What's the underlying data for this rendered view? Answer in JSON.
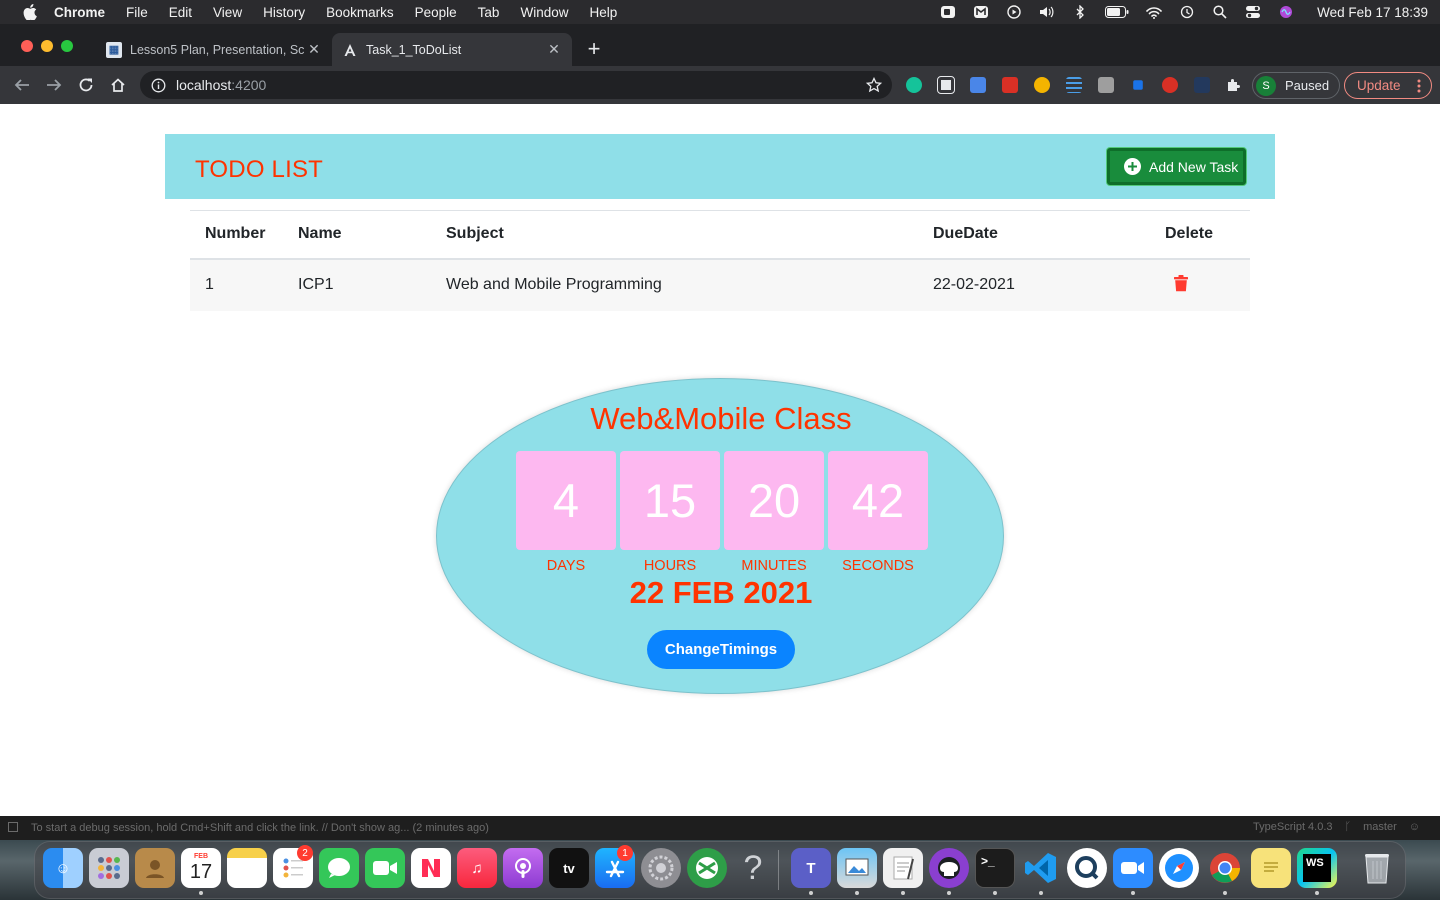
{
  "menubar": {
    "app_name": "Chrome",
    "items": [
      "File",
      "Edit",
      "View",
      "History",
      "Bookmarks",
      "People",
      "Tab",
      "Window",
      "Help"
    ],
    "clock": "Wed Feb 17  18:39"
  },
  "browser": {
    "tabs": [
      {
        "title": "Lesson5 Plan, Presentation, Sc",
        "active": false
      },
      {
        "title": "Task_1_ToDoList",
        "active": true
      }
    ],
    "address": {
      "host": "localhost",
      "port": ":4200"
    },
    "profile": {
      "initial": "S",
      "label": "Paused"
    },
    "update_label": "Update"
  },
  "todo": {
    "title": "TODO LIST",
    "add_button_label": "Add New Task",
    "columns": [
      "Number",
      "Name",
      "Subject",
      "DueDate",
      "Delete"
    ],
    "rows": [
      {
        "number": "1",
        "name": "ICP1",
        "subject": "Web and Mobile Programming",
        "due_date": "22-02-2021"
      }
    ]
  },
  "countdown": {
    "title": "Web&Mobile Class",
    "days": "4",
    "hours": "15",
    "minutes": "20",
    "seconds": "42",
    "labels": {
      "days": "DAYS",
      "hours": "HOURS",
      "minutes": "MINUTES",
      "seconds": "SECONDS"
    },
    "target_date": "22 FEB 2021",
    "change_button_label": "ChangeTimings"
  },
  "editor_status": {
    "message": "To start a debug session, hold Cmd+Shift and click the link. // Don't show ag... (2 minutes ago)",
    "language": "TypeScript 4.0.3",
    "branch": "master"
  },
  "dock": {
    "calendar_month": "FEB",
    "calendar_day": "17",
    "reminders_badge": "2",
    "appstore_badge": "1",
    "tv_label": "tv",
    "webstorm_label": "WS"
  },
  "colors": {
    "accent_red": "#ff3300",
    "header_cyan": "#8fdfe8",
    "timer_pink": "#fdb8f0",
    "add_green": "#198c3c",
    "change_blue": "#0a84ff"
  }
}
